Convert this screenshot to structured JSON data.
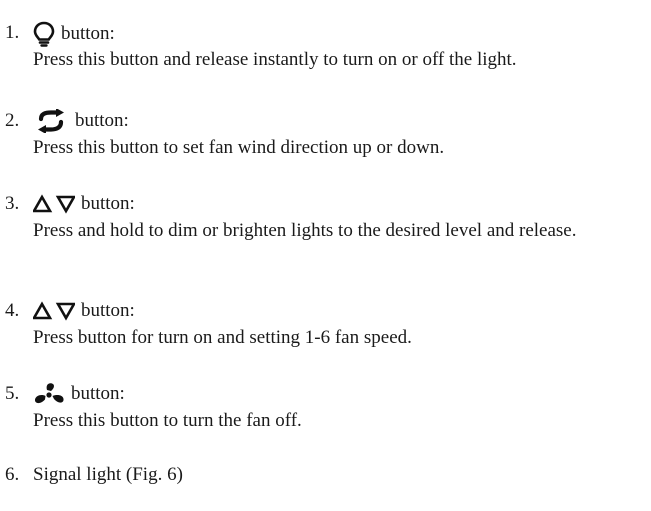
{
  "items": [
    {
      "number": "1.",
      "icon": "light-bulb-icon",
      "label": "button:",
      "description": "Press this button and release instantly to turn on or off the light."
    },
    {
      "number": "2.",
      "icon": "reverse-arrows-icon",
      "label": "button:",
      "description": "Press this button to set fan wind direction up or down."
    },
    {
      "number": "3.",
      "icon": "up-down-triangles-icon",
      "label": "button:",
      "description": "Press and hold to dim or brighten lights to the desired level and release."
    },
    {
      "number": "4.",
      "icon": "up-down-triangles-icon",
      "label": "button:",
      "description": "Press button for turn on and setting 1-6 fan speed."
    },
    {
      "number": "5.",
      "icon": "fan-icon",
      "label": "button:",
      "description": "Press this button to turn the fan off."
    },
    {
      "number": "6.",
      "label": "Signal light (Fig. 6)"
    }
  ]
}
